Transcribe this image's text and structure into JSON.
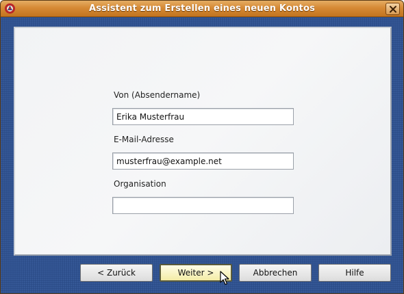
{
  "window": {
    "title": "Assistent zum Erstellen eines neuen Kontos",
    "icons": {
      "app": "thunderbird-app-icon",
      "close": "close-icon",
      "cursor": "mouse-pointer-icon"
    }
  },
  "form": {
    "sender_name": {
      "label": "Von (Absendername)",
      "value": "Erika Musterfrau"
    },
    "email": {
      "label": "E-Mail-Adresse",
      "value": "musterfrau@example.net"
    },
    "organization": {
      "label": "Organisation",
      "value": ""
    }
  },
  "buttons": {
    "back": "< Zurück",
    "next": "Weiter >",
    "cancel": "Abbrechen",
    "help": "Hilfe"
  },
  "colors": {
    "titlebar": "#d68a35",
    "background": "#2a4a86",
    "panel": "#f2f3f5",
    "next_button": "#f3eca6"
  }
}
